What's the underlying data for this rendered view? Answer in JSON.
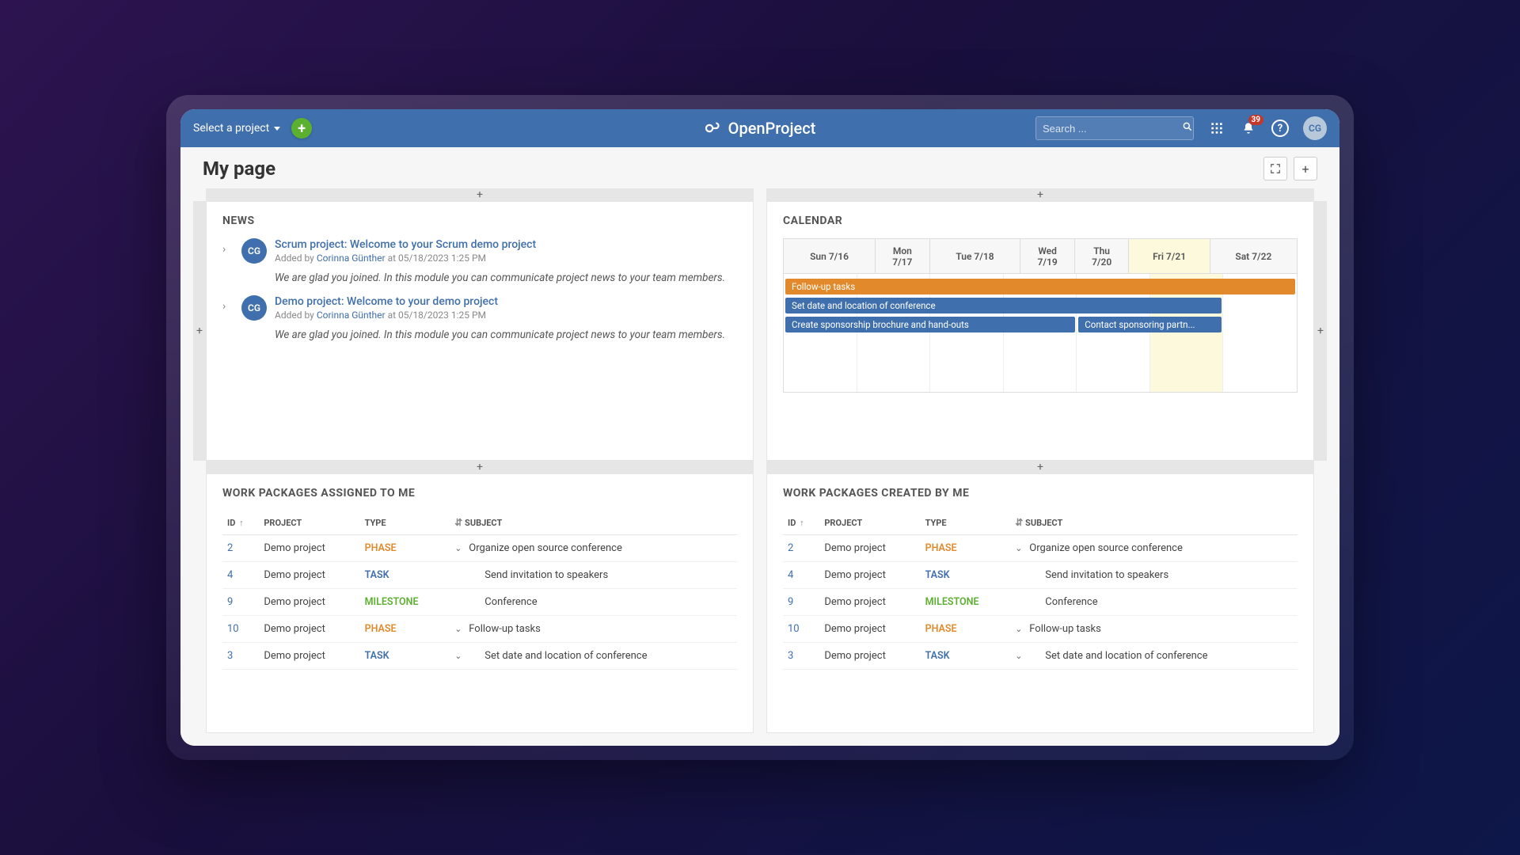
{
  "header": {
    "project_selector": "Select a project",
    "brand": "OpenProject",
    "search_placeholder": "Search ...",
    "notification_count": "39",
    "avatar_initials": "CG"
  },
  "page": {
    "title": "My page"
  },
  "news": {
    "title": "NEWS",
    "items": [
      {
        "avatar": "CG",
        "link": "Scrum project: Welcome to your Scrum demo project",
        "added_by_prefix": "Added by ",
        "author": "Corinna Günther",
        "at_text": " at 05/18/2023 1:25 PM",
        "desc": "We are glad you joined. In this module you can communicate project news to your team members."
      },
      {
        "avatar": "CG",
        "link": "Demo project: Welcome to your demo project",
        "added_by_prefix": "Added by ",
        "author": "Corinna Günther",
        "at_text": " at 05/18/2023 1:25 PM",
        "desc": "We are glad you joined. In this module you can communicate project news to your team members."
      }
    ]
  },
  "calendar": {
    "title": "CALENDAR",
    "days": [
      "Sun 7/16",
      "Mon 7/17",
      "Tue 7/18",
      "Wed 7/19",
      "Thu 7/20",
      "Fri 7/21",
      "Sat 7/22"
    ],
    "today_index": 5,
    "events": [
      {
        "label": "Follow-up tasks",
        "color": "orange",
        "start": 0,
        "span": 7,
        "row": 0
      },
      {
        "label": "Set date and location of conference",
        "color": "blue",
        "start": 0,
        "span": 6,
        "row": 1
      },
      {
        "label": "Create sponsorship brochure and hand-outs",
        "color": "blue",
        "start": 0,
        "span": 4,
        "row": 2
      },
      {
        "label": "Contact sponsoring partn...",
        "color": "blue",
        "start": 4,
        "span": 2,
        "row": 2
      }
    ]
  },
  "assigned": {
    "title": "WORK PACKAGES ASSIGNED TO ME",
    "cols": {
      "id": "ID",
      "project": "PROJECT",
      "type": "TYPE",
      "subject": "SUBJECT"
    },
    "rows": [
      {
        "id": "2",
        "project": "Demo project",
        "type": "PHASE",
        "subject": "Organize open source conference",
        "toggle": "v"
      },
      {
        "id": "4",
        "project": "Demo project",
        "type": "TASK",
        "subject": "Send invitation to speakers",
        "toggle": ""
      },
      {
        "id": "9",
        "project": "Demo project",
        "type": "MILESTONE",
        "subject": "Conference",
        "toggle": ""
      },
      {
        "id": "10",
        "project": "Demo project",
        "type": "PHASE",
        "subject": "Follow-up tasks",
        "toggle": "v"
      },
      {
        "id": "3",
        "project": "Demo project",
        "type": "TASK",
        "subject": "Set date and location of conference",
        "toggle": "v"
      }
    ]
  },
  "created": {
    "title": "WORK PACKAGES CREATED BY ME",
    "cols": {
      "id": "ID",
      "project": "PROJECT",
      "type": "TYPE",
      "subject": "SUBJECT"
    },
    "rows": [
      {
        "id": "2",
        "project": "Demo project",
        "type": "PHASE",
        "subject": "Organize open source conference",
        "toggle": "v"
      },
      {
        "id": "4",
        "project": "Demo project",
        "type": "TASK",
        "subject": "Send invitation to speakers",
        "toggle": ""
      },
      {
        "id": "9",
        "project": "Demo project",
        "type": "MILESTONE",
        "subject": "Conference",
        "toggle": ""
      },
      {
        "id": "10",
        "project": "Demo project",
        "type": "PHASE",
        "subject": "Follow-up tasks",
        "toggle": "v"
      },
      {
        "id": "3",
        "project": "Demo project",
        "type": "TASK",
        "subject": "Set date and location of conference",
        "toggle": "v"
      }
    ]
  }
}
